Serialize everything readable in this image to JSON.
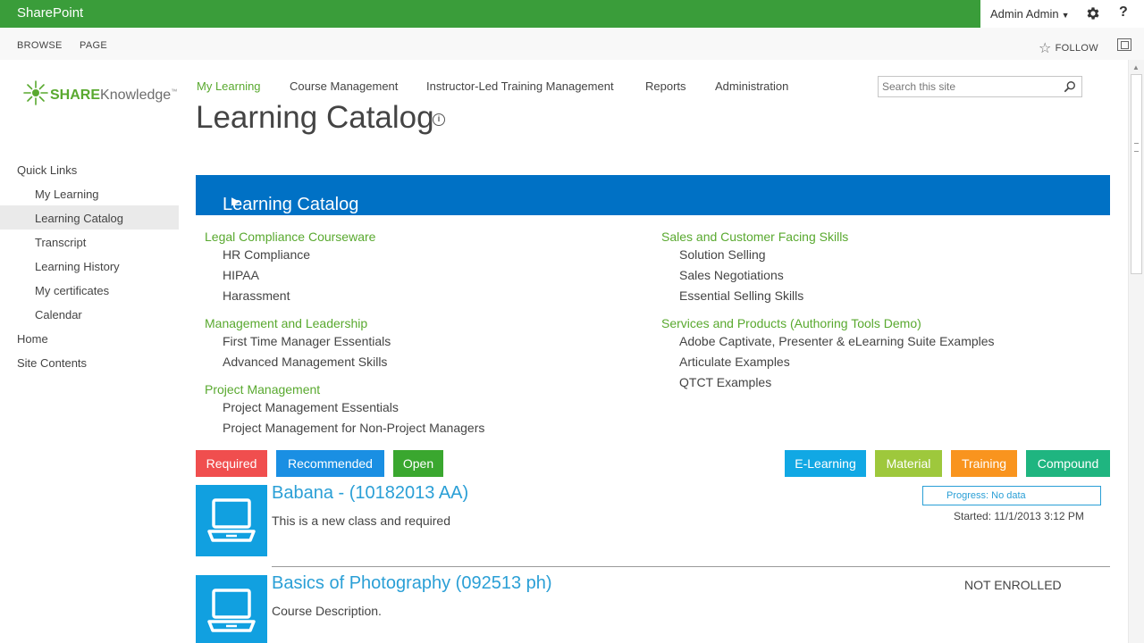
{
  "suitebar": {
    "brand": "SharePoint",
    "user": "Admin Admin",
    "help": "?"
  },
  "ribbon": {
    "tabs": [
      "BROWSE",
      "PAGE"
    ],
    "follow": "FOLLOW"
  },
  "logo": {
    "share": "SHARE",
    "knowledge": "Knowledge",
    "tm": "™"
  },
  "topnav": [
    "My Learning",
    "Course Management",
    "Instructor-Led Training Management",
    "Reports",
    "Administration"
  ],
  "search": {
    "placeholder": "Search this site"
  },
  "page": {
    "title": "Learning Catalog",
    "info": "i"
  },
  "quicklaunch": {
    "heading": "Quick Links",
    "sub_items": [
      "My Learning",
      "Learning Catalog",
      "Transcript",
      "Learning History",
      "My certificates",
      "Calendar"
    ],
    "top_items": [
      "Home",
      "Site Contents"
    ]
  },
  "catalog": {
    "band_title": "Learning Catalog",
    "band_arrow": "▶",
    "left_column": [
      {
        "heading": "Legal Compliance Courseware",
        "items": [
          "HR Compliance",
          "HIPAA",
          "Harassment"
        ]
      },
      {
        "heading": "Management and Leadership",
        "items": [
          "First Time Manager Essentials",
          "Advanced Management Skills"
        ]
      },
      {
        "heading": "Project Management",
        "items": [
          "Project Management Essentials",
          "Project Management for Non-Project Managers"
        ]
      }
    ],
    "right_column": [
      {
        "heading": "Sales and Customer Facing Skills",
        "items": [
          "Solution Selling",
          "Sales Negotiations",
          "Essential Selling Skills"
        ]
      },
      {
        "heading": "Services and Products (Authoring Tools Demo)",
        "items": [
          "Adobe Captivate, Presenter & eLearning Suite Examples",
          "Articulate Examples",
          "QTCT Examples"
        ]
      }
    ]
  },
  "filters": {
    "status": [
      {
        "label": "Required",
        "color": "#f04e4e"
      },
      {
        "label": "Recommended",
        "color": "#1a8fe3"
      },
      {
        "label": "Open",
        "color": "#3aa72f"
      }
    ],
    "type": [
      {
        "label": "E-Learning",
        "color": "#11a8e4"
      },
      {
        "label": "Material",
        "color": "#9ec83c"
      },
      {
        "label": "Training",
        "color": "#f9941e"
      },
      {
        "label": "Compound",
        "color": "#1fb580"
      }
    ]
  },
  "courses": [
    {
      "title": "Babana - (10182013 AA)",
      "description": "This is a new class and required",
      "progress": "Progress:  No data",
      "started": "Started:  11/1/2013 3:12 PM"
    },
    {
      "title": "Basics of Photography (092513 ph)",
      "description": "Course Description.",
      "status": "NOT ENROLLED"
    }
  ]
}
